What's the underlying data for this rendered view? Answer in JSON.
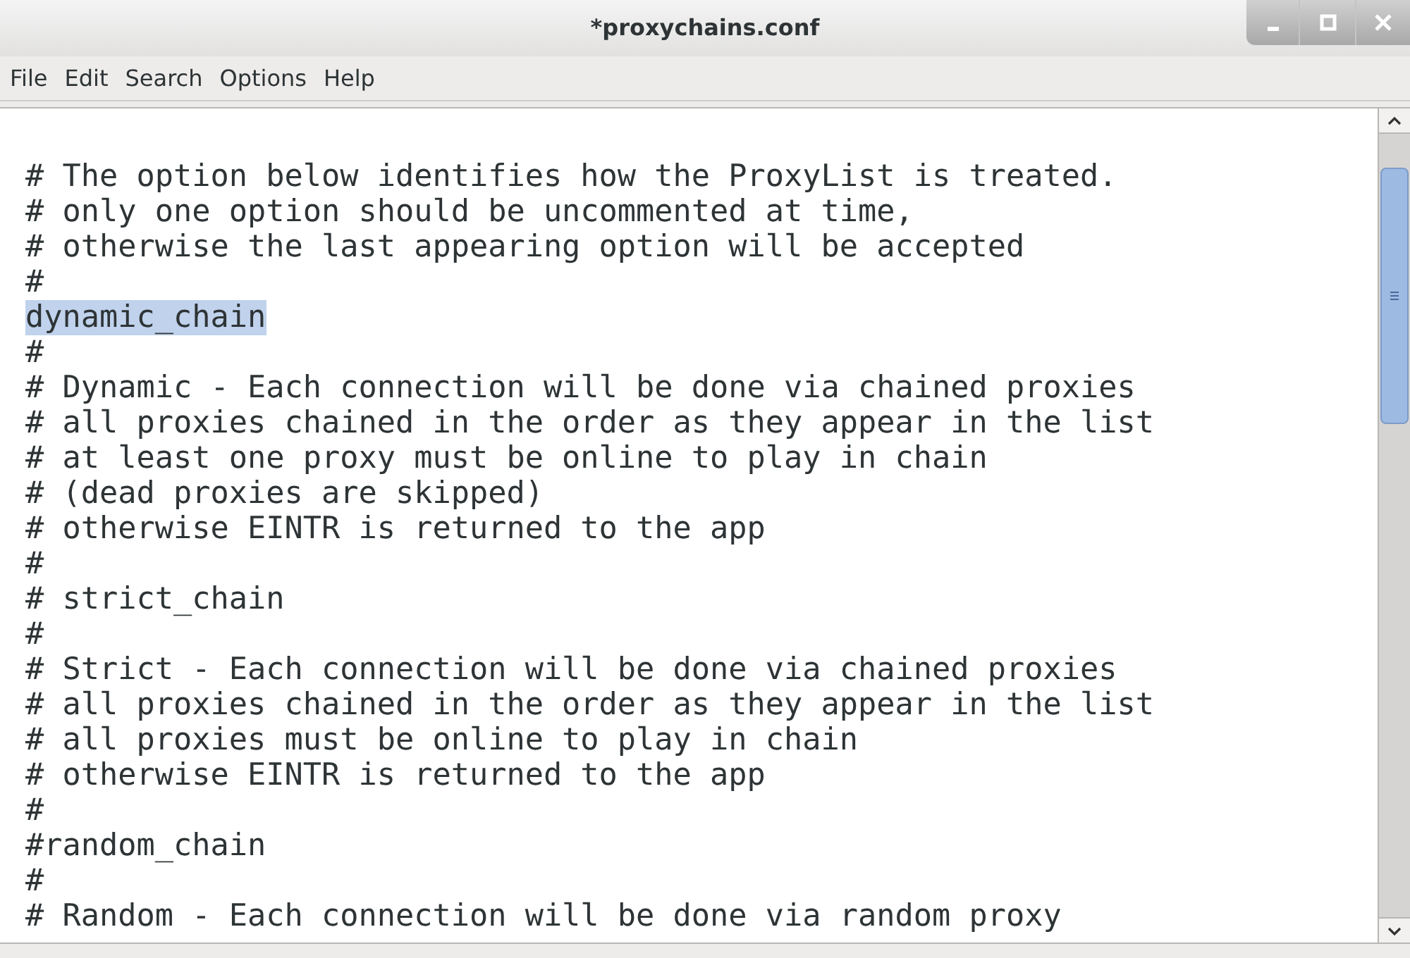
{
  "window": {
    "title": "*proxychains.conf"
  },
  "menu": [
    "File",
    "Edit",
    "Search",
    "Options",
    "Help"
  ],
  "lines": [
    {
      "text": "# The option below identifies how the ProxyList is treated.",
      "selected": false
    },
    {
      "text": "# only one option should be uncommented at time,",
      "selected": false
    },
    {
      "text": "# otherwise the last appearing option will be accepted",
      "selected": false
    },
    {
      "text": "#",
      "selected": false
    },
    {
      "text": "dynamic_chain",
      "selected": true
    },
    {
      "text": "#",
      "selected": false
    },
    {
      "text": "# Dynamic - Each connection will be done via chained proxies",
      "selected": false
    },
    {
      "text": "# all proxies chained in the order as they appear in the list",
      "selected": false
    },
    {
      "text": "# at least one proxy must be online to play in chain",
      "selected": false
    },
    {
      "text": "# (dead proxies are skipped)",
      "selected": false
    },
    {
      "text": "# otherwise EINTR is returned to the app",
      "selected": false
    },
    {
      "text": "#",
      "selected": false
    },
    {
      "text": "# strict_chain",
      "selected": false
    },
    {
      "text": "#",
      "selected": false
    },
    {
      "text": "# Strict - Each connection will be done via chained proxies",
      "selected": false
    },
    {
      "text": "# all proxies chained in the order as they appear in the list",
      "selected": false
    },
    {
      "text": "# all proxies must be online to play in chain",
      "selected": false
    },
    {
      "text": "# otherwise EINTR is returned to the app",
      "selected": false
    },
    {
      "text": "#",
      "selected": false
    },
    {
      "text": "#random_chain",
      "selected": false
    },
    {
      "text": "#",
      "selected": false
    },
    {
      "text": "# Random - Each connection will be done via random proxy",
      "selected": false
    }
  ]
}
